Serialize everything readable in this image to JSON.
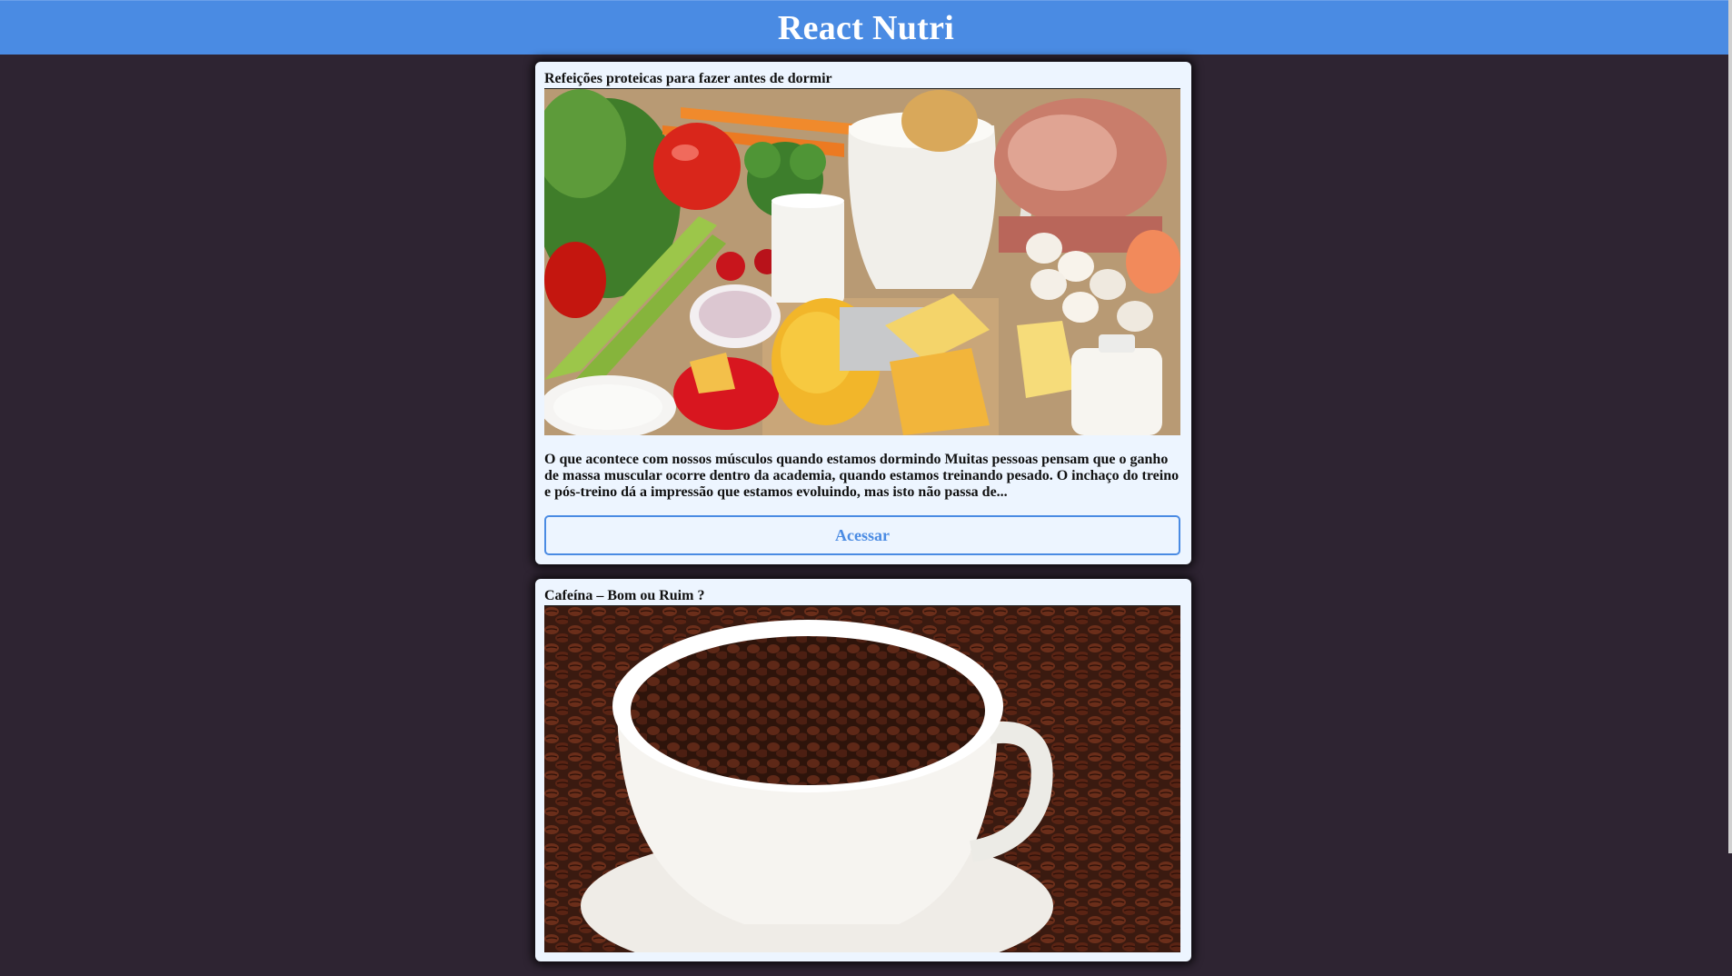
{
  "header": {
    "title": "React Nutri"
  },
  "posts": [
    {
      "title": "Refeições proteicas para fazer antes de dormir",
      "excerpt": "O que acontece com nossos músculos quando estamos dormindo Muitas pessoas pensam que o ganho de massa muscular ocorre dentro da academia, quando estamos treinando pesado. O inchaço do treino e pós-treino dá a impressão que estamos evoluindo, mas isto não passa de...",
      "button_label": "Acessar"
    },
    {
      "title": "Cafeína – Bom ou Ruim ?"
    }
  ],
  "colors": {
    "header_bg": "#4a8be3",
    "page_bg": "#2e2432",
    "card_bg": "#edf5ff",
    "accent": "#4a8be3"
  }
}
